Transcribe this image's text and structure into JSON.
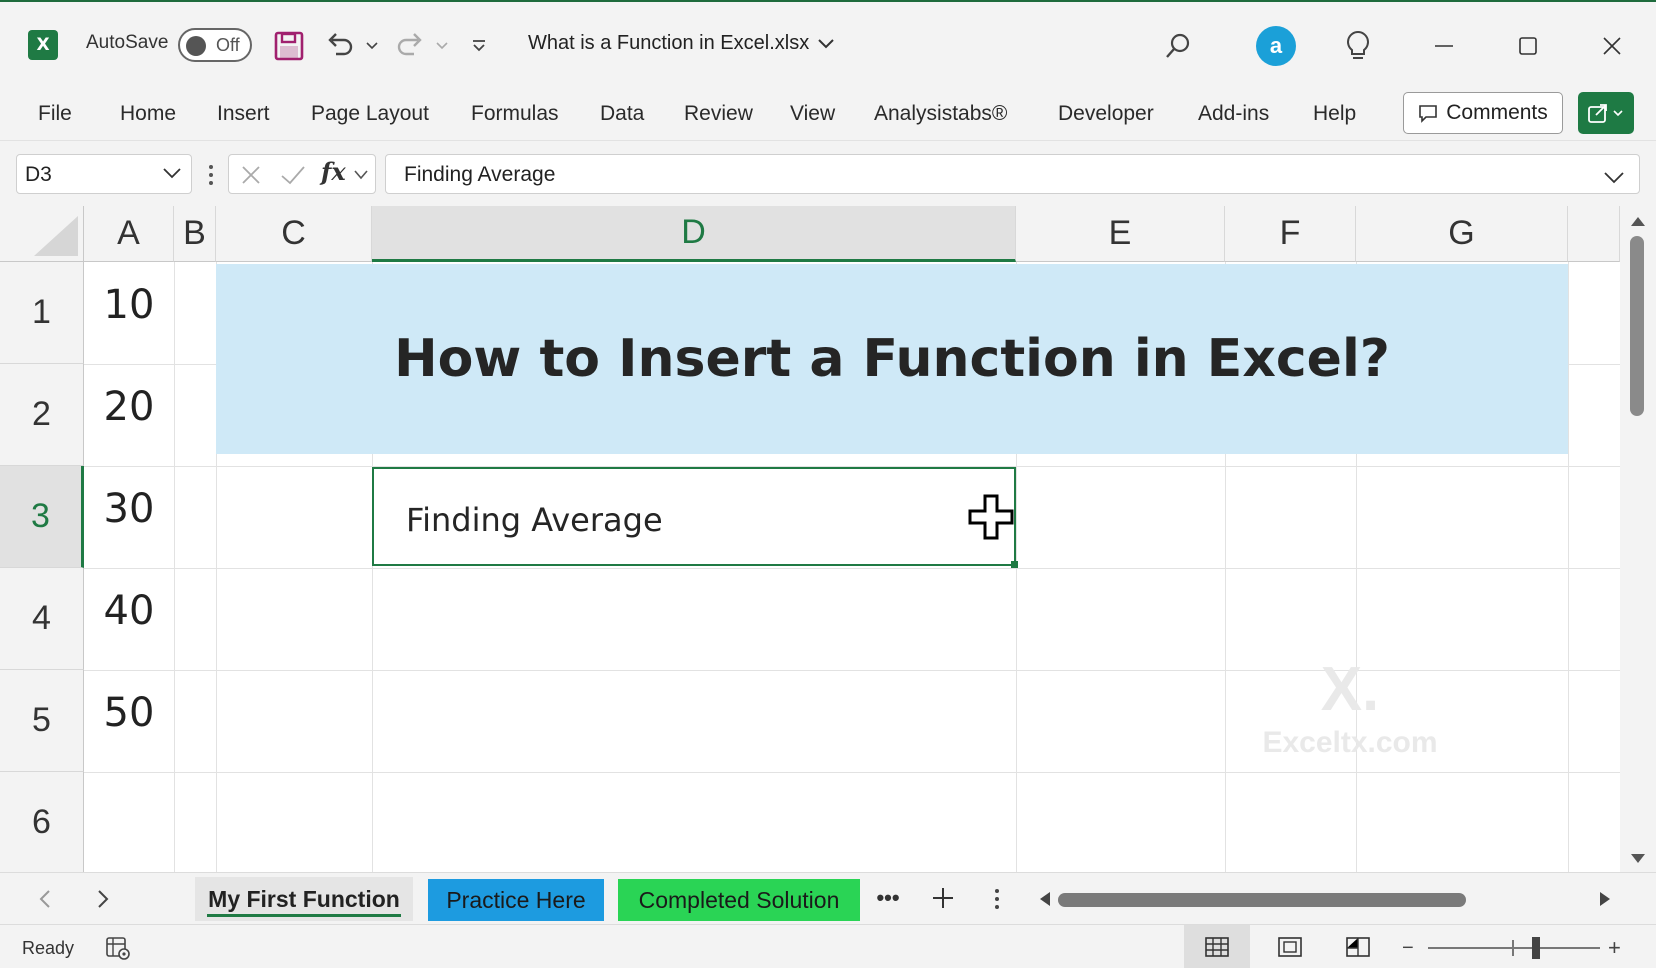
{
  "app": {
    "autosave_label": "AutoSave",
    "autosave_state": "Off",
    "file_title": "What is a Function in Excel.xlsx",
    "addin_avatar_letter": "a"
  },
  "ribbon": {
    "tabs": [
      "File",
      "Home",
      "Insert",
      "Page Layout",
      "Formulas",
      "Data",
      "Review",
      "View",
      "Analysistabs®",
      "Developer",
      "Add-ins",
      "Help"
    ],
    "comments_label": "Comments"
  },
  "formula_bar": {
    "name_box": "D3",
    "fx_label": "fx",
    "formula": "Finding Average"
  },
  "grid": {
    "columns": [
      "A",
      "B",
      "C",
      "D",
      "E",
      "F",
      "G"
    ],
    "rows": [
      "1",
      "2",
      "3",
      "4",
      "5",
      "6"
    ],
    "selected_column": "D",
    "selected_row": "3",
    "column_a_values": [
      "10",
      "20",
      "30",
      "40",
      "50"
    ],
    "title_banner": "How to Insert a Function in Excel?",
    "active_cell_text": "Finding Average",
    "watermark_mark": "X.",
    "watermark_text": "Exceltx.com"
  },
  "sheets": {
    "tabs": [
      {
        "label": "My First Function",
        "active": true
      },
      {
        "label": "Practice Here",
        "color": "#1d9be0"
      },
      {
        "label": "Completed Solution",
        "color": "#2ad455"
      }
    ],
    "more_label": "•••"
  },
  "status": {
    "text": "Ready"
  },
  "theme": {
    "accent": "#1f7a44",
    "banner_bg": "#cfe9f7"
  }
}
